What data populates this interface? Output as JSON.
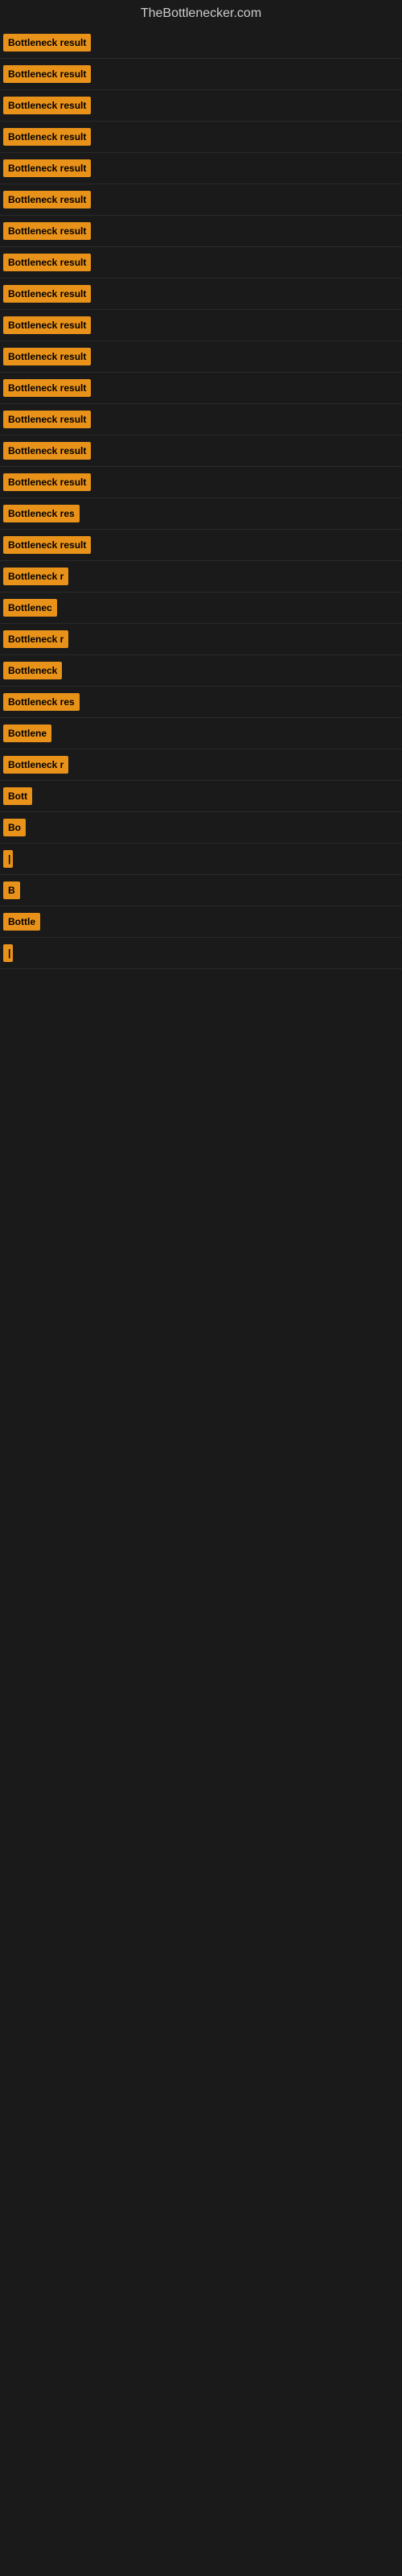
{
  "site": {
    "title": "TheBottlenecker.com"
  },
  "items": [
    {
      "id": 1,
      "label": "Bottleneck result",
      "width_class": "w-140"
    },
    {
      "id": 2,
      "label": "Bottleneck result",
      "width_class": "w-140"
    },
    {
      "id": 3,
      "label": "Bottleneck result",
      "width_class": "w-140"
    },
    {
      "id": 4,
      "label": "Bottleneck result",
      "width_class": "w-140"
    },
    {
      "id": 5,
      "label": "Bottleneck result",
      "width_class": "w-140"
    },
    {
      "id": 6,
      "label": "Bottleneck result",
      "width_class": "w-140"
    },
    {
      "id": 7,
      "label": "Bottleneck result",
      "width_class": "w-140"
    },
    {
      "id": 8,
      "label": "Bottleneck result",
      "width_class": "w-140"
    },
    {
      "id": 9,
      "label": "Bottleneck result",
      "width_class": "w-140"
    },
    {
      "id": 10,
      "label": "Bottleneck result",
      "width_class": "w-140"
    },
    {
      "id": 11,
      "label": "Bottleneck result",
      "width_class": "w-140"
    },
    {
      "id": 12,
      "label": "Bottleneck result",
      "width_class": "w-135"
    },
    {
      "id": 13,
      "label": "Bottleneck result",
      "width_class": "w-130"
    },
    {
      "id": 14,
      "label": "Bottleneck result",
      "width_class": "w-125"
    },
    {
      "id": 15,
      "label": "Bottleneck result",
      "width_class": "w-120"
    },
    {
      "id": 16,
      "label": "Bottleneck res",
      "width_class": "w-105"
    },
    {
      "id": 17,
      "label": "Bottleneck result",
      "width_class": "w-115"
    },
    {
      "id": 18,
      "label": "Bottleneck r",
      "width_class": "w-95"
    },
    {
      "id": 19,
      "label": "Bottlenec",
      "width_class": "w-85"
    },
    {
      "id": 20,
      "label": "Bottleneck r",
      "width_class": "w-95"
    },
    {
      "id": 21,
      "label": "Bottleneck",
      "width_class": "w-90"
    },
    {
      "id": 22,
      "label": "Bottleneck res",
      "width_class": "w-105"
    },
    {
      "id": 23,
      "label": "Bottlene",
      "width_class": "w-80"
    },
    {
      "id": 24,
      "label": "Bottleneck r",
      "width_class": "w-95"
    },
    {
      "id": 25,
      "label": "Bott",
      "width_class": "w-60"
    },
    {
      "id": 26,
      "label": "Bo",
      "width_class": "w-40"
    },
    {
      "id": 27,
      "label": "|",
      "width_class": "w-10"
    },
    {
      "id": 28,
      "label": "B",
      "width_class": "w-25"
    },
    {
      "id": 29,
      "label": "Bottle",
      "width_class": "w-65"
    },
    {
      "id": 30,
      "label": "|",
      "width_class": "w-8"
    }
  ]
}
